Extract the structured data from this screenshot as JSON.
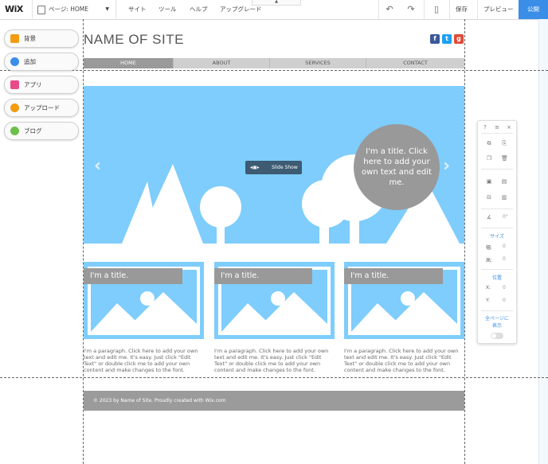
{
  "topbar": {
    "logo": "WiX",
    "page_selector": "ページ: HOME",
    "menu": [
      "サイト",
      "ツール",
      "ヘルプ",
      "アップグレード"
    ],
    "save": "保存",
    "preview": "プレビュー",
    "publish": "公開"
  },
  "left_panel": [
    {
      "label": "背景",
      "color": "#f39c12"
    },
    {
      "label": "追加",
      "color": "#3b8ee8"
    },
    {
      "label": "アプリ",
      "color": "#e84a8a"
    },
    {
      "label": "アップロード",
      "color": "#f39c12"
    },
    {
      "label": "ブログ",
      "color": "#6cc04a"
    }
  ],
  "site": {
    "name": "NAME OF SITE",
    "nav": [
      "HOME",
      "ABOUT",
      "SERVICES",
      "CONTACT"
    ],
    "slideshow_label": "Slide Show",
    "slide_title": "I'm a title. Click here to add your own text and edit me.",
    "columns": [
      {
        "title": "I'm a title.",
        "text": "I'm a paragraph. Click here to add your own text and edit me. It's easy. Just click \"Edit Text\" or double click me to add your own content and make changes to the font."
      },
      {
        "title": "I'm a title.",
        "text": "I'm a paragraph. Click here to add your own text and edit me. It's easy. Just click \"Edit Text\" or double click me to add your own content and make changes to the font."
      },
      {
        "title": "I'm a title.",
        "text": "I'm a paragraph. Click here to add your own text and edit me. It's easy. Just click \"Edit Text\" or double click me to add your own content and make changes to the font."
      }
    ],
    "footer": "© 2023 by Name of Site. Proudly created with Wix.com"
  },
  "tool_panel": {
    "help": "?",
    "close": "×",
    "rotation": "0°",
    "size_label": "サイズ",
    "width_label": "幅:",
    "height_label": "高:",
    "width_value": "0",
    "height_value": "0",
    "position_label": "位置",
    "x_label": "X:",
    "y_label": "Y:",
    "x_value": "0",
    "y_value": "0",
    "all_pages_line1": "全ページに",
    "all_pages_line2": "表示"
  },
  "colors": {
    "accent": "#3b8ee8",
    "slide_bg": "#7ecdfc",
    "gray_box": "#999999",
    "facebook": "#3b5998",
    "twitter": "#1da1f2",
    "googleplus": "#dd4b39"
  }
}
